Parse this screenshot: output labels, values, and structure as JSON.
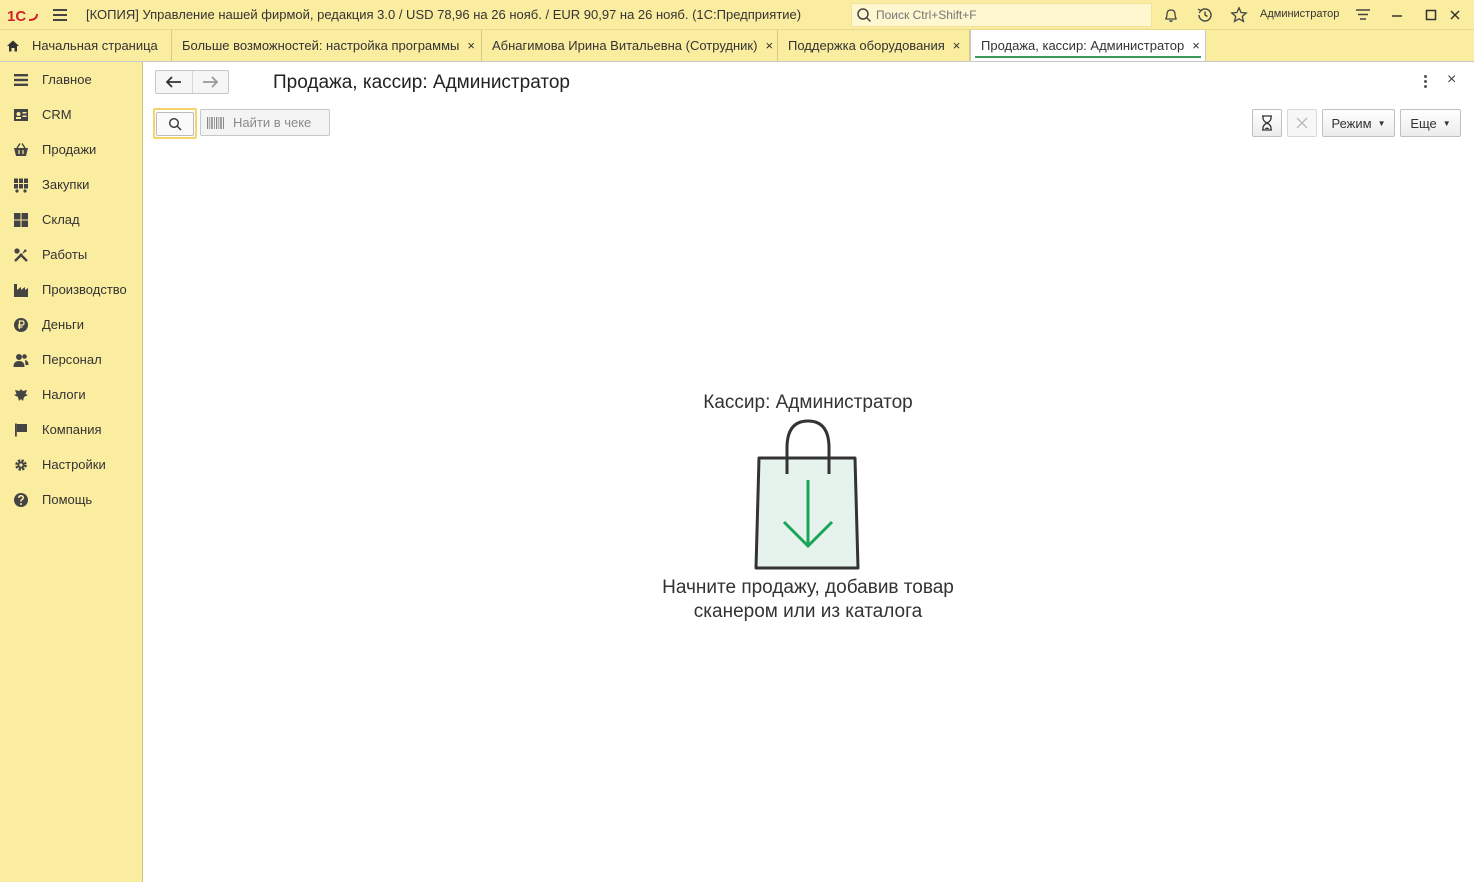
{
  "titlebar": {
    "logo_text": "1С",
    "title": "[КОПИЯ] Управление нашей фирмой, редакция 3.0 / USD 78,96 на 26 нояб. / EUR 90,97 на 26 нояб.  (1С:Предприятие)",
    "search_placeholder": "Поиск Ctrl+Shift+F",
    "user": "Администратор",
    "icons": [
      "bell-icon",
      "history-icon",
      "star-icon",
      "settings-lines-icon",
      "minimize-icon",
      "maximize-icon",
      "close-icon"
    ]
  },
  "tabs": [
    {
      "label": "Начальная страница",
      "home": true
    },
    {
      "label": "Больше возможностей: настройка программы",
      "closable": true
    },
    {
      "label": "Абнагимова Ирина Витальевна (Сотрудник)",
      "closable": true
    },
    {
      "label": "Поддержка оборудования",
      "closable": true
    },
    {
      "label": "Продажа, кассир: Администратор",
      "closable": true,
      "active": true
    }
  ],
  "close_glyph": "×",
  "sidebar": {
    "items": [
      {
        "label": "Главное",
        "icon": "list-icon"
      },
      {
        "label": "CRM",
        "icon": "crm-icon"
      },
      {
        "label": "Продажи",
        "icon": "basket-icon"
      },
      {
        "label": "Закупки",
        "icon": "cart-icon"
      },
      {
        "label": "Склад",
        "icon": "warehouse-icon"
      },
      {
        "label": "Работы",
        "icon": "tools-icon"
      },
      {
        "label": "Производство",
        "icon": "factory-icon"
      },
      {
        "label": "Деньги",
        "icon": "ruble-icon"
      },
      {
        "label": "Персонал",
        "icon": "people-icon"
      },
      {
        "label": "Налоги",
        "icon": "eagle-icon"
      },
      {
        "label": "Компания",
        "icon": "flag-icon"
      },
      {
        "label": "Настройки",
        "icon": "gear-icon"
      },
      {
        "label": "Помощь",
        "icon": "help-icon"
      }
    ]
  },
  "form": {
    "title": "Продажа, кассир: Администратор",
    "find_placeholder": "Найти в чеке",
    "mode_button": "Режим",
    "more_button": "Еще",
    "cashier_label": "Кассир: Администратор",
    "hint_line1": "Начните продажу, добавив товар",
    "hint_line2": "сканером или из каталога"
  },
  "colors": {
    "panel": "#fbeda0",
    "accent_green": "#1aa55a",
    "bag_fill": "#e6f2ec"
  }
}
